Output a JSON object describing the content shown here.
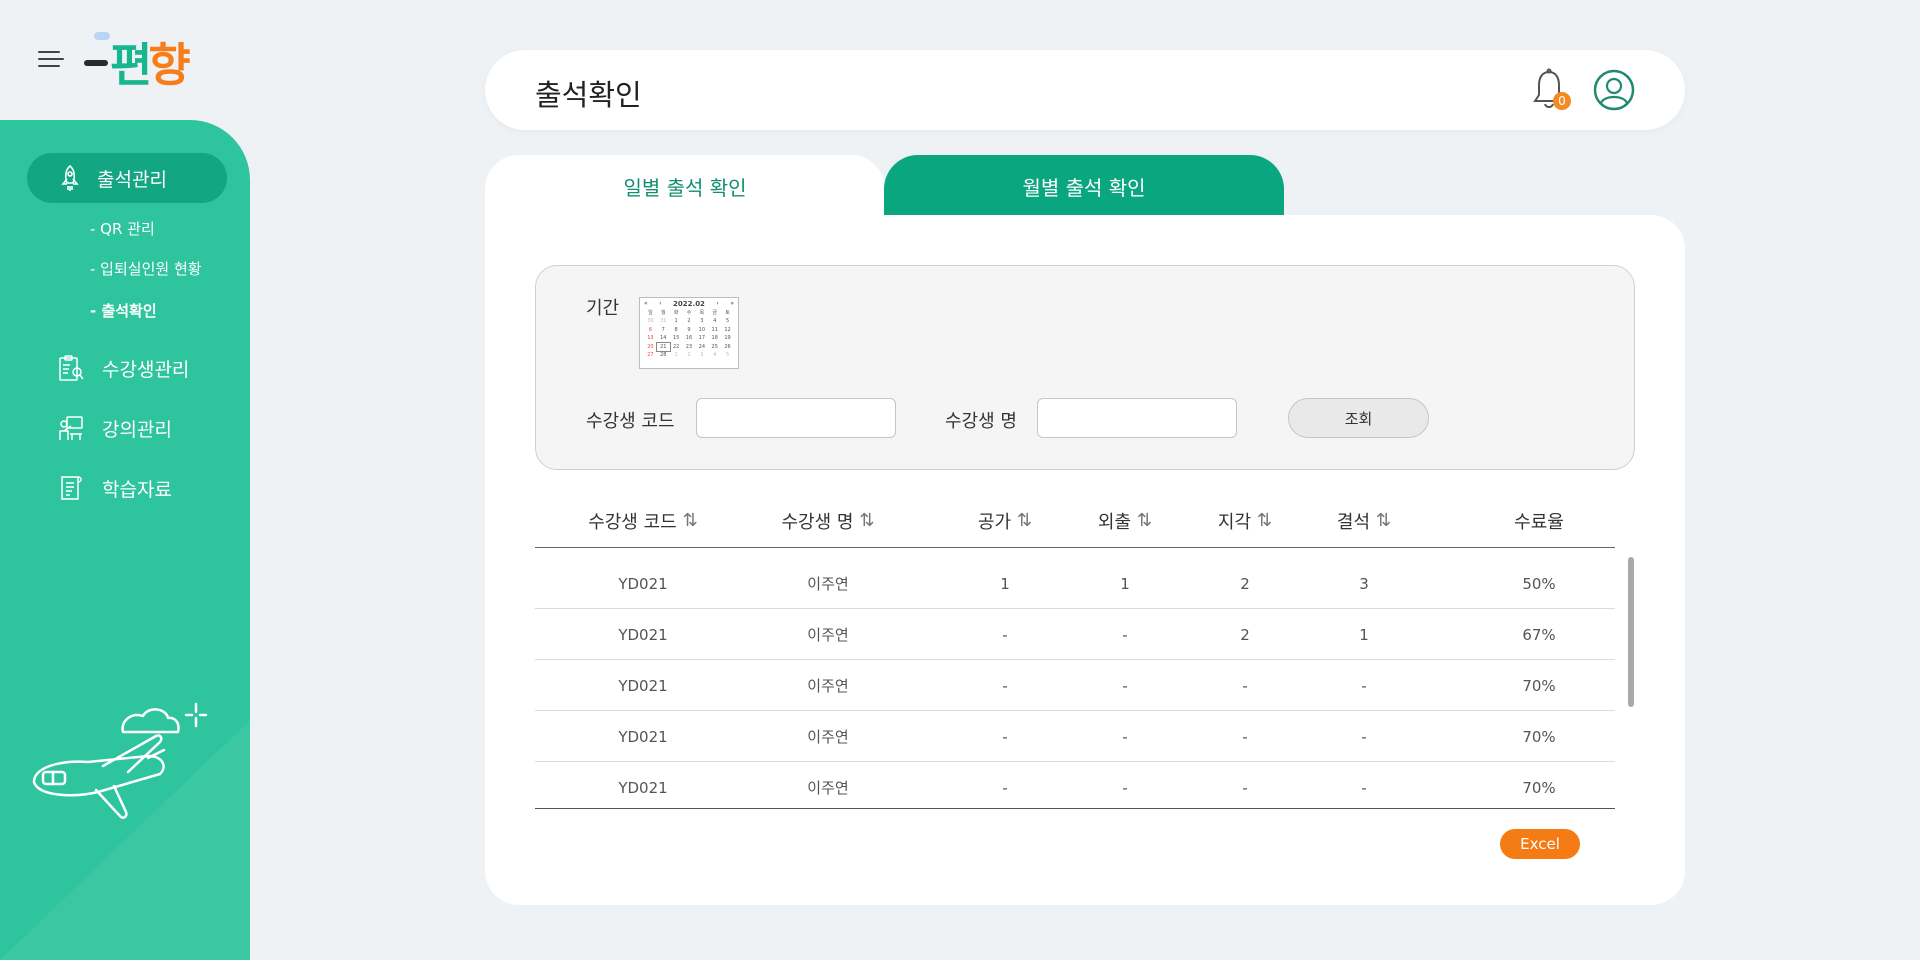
{
  "brand": {
    "logo_part1": "편",
    "logo_part2": "향"
  },
  "sidebar": {
    "active_menu": {
      "label": "출석관리",
      "icon": "rocket-icon"
    },
    "submenus": [
      {
        "label": "- QR 관리"
      },
      {
        "label": "- 입퇴실인원 현황"
      },
      {
        "label": "- 출석확인",
        "active": true
      }
    ],
    "menus": [
      {
        "label": "수강생관리",
        "icon": "student-clipboard-icon"
      },
      {
        "label": "강의관리",
        "icon": "lecture-icon"
      },
      {
        "label": "학습자료",
        "icon": "document-icon"
      }
    ]
  },
  "header": {
    "title": "출석확인",
    "notification_count": "0"
  },
  "tabs": [
    {
      "label": "일별 출석 확인",
      "active": true
    },
    {
      "label": "월별 출석 확인",
      "active": false
    }
  ],
  "filter": {
    "period_label": "기간",
    "calendar": {
      "year_month": "2022.02",
      "prev_year": "«",
      "prev_month": "‹",
      "next_month": "›",
      "next_year": "»",
      "weekdays": [
        "일",
        "월",
        "화",
        "수",
        "목",
        "금",
        "토"
      ],
      "rows": [
        [
          "30",
          "31",
          "1",
          "2",
          "3",
          "4",
          "5"
        ],
        [
          "6",
          "7",
          "8",
          "9",
          "10",
          "11",
          "12"
        ],
        [
          "13",
          "14",
          "15",
          "16",
          "17",
          "18",
          "19"
        ],
        [
          "20",
          "21",
          "22",
          "23",
          "24",
          "25",
          "26"
        ],
        [
          "27",
          "28",
          "1",
          "2",
          "3",
          "4",
          "5"
        ]
      ]
    },
    "code_label": "수강생 코드",
    "code_value": "",
    "name_label": "수강생 명",
    "name_value": "",
    "search_button": "조회"
  },
  "table": {
    "columns": [
      "수강생 코드",
      "수강생 명",
      "공가",
      "외출",
      "지각",
      "결석",
      "수료율"
    ],
    "sort_glyph": "⇅",
    "rows": [
      [
        "YD021",
        "이주연",
        "1",
        "1",
        "2",
        "3",
        "50%"
      ],
      [
        "YD021",
        "이주연",
        "-",
        "-",
        "2",
        "1",
        "67%"
      ],
      [
        "YD021",
        "이주연",
        "-",
        "-",
        "-",
        "-",
        "70%"
      ],
      [
        "YD021",
        "이주연",
        "-",
        "-",
        "-",
        "-",
        "70%"
      ],
      [
        "YD021",
        "이주연",
        "-",
        "-",
        "-",
        "-",
        "70%"
      ]
    ]
  },
  "excel_button": "Excel",
  "colors": {
    "sidebar": "#2ec49d",
    "active_menu": "#12a683",
    "tab_active_text": "#128f6f",
    "tab_inactive_bg": "#0aa67f",
    "excel": "#f57b14",
    "badge": "#f48a24"
  }
}
